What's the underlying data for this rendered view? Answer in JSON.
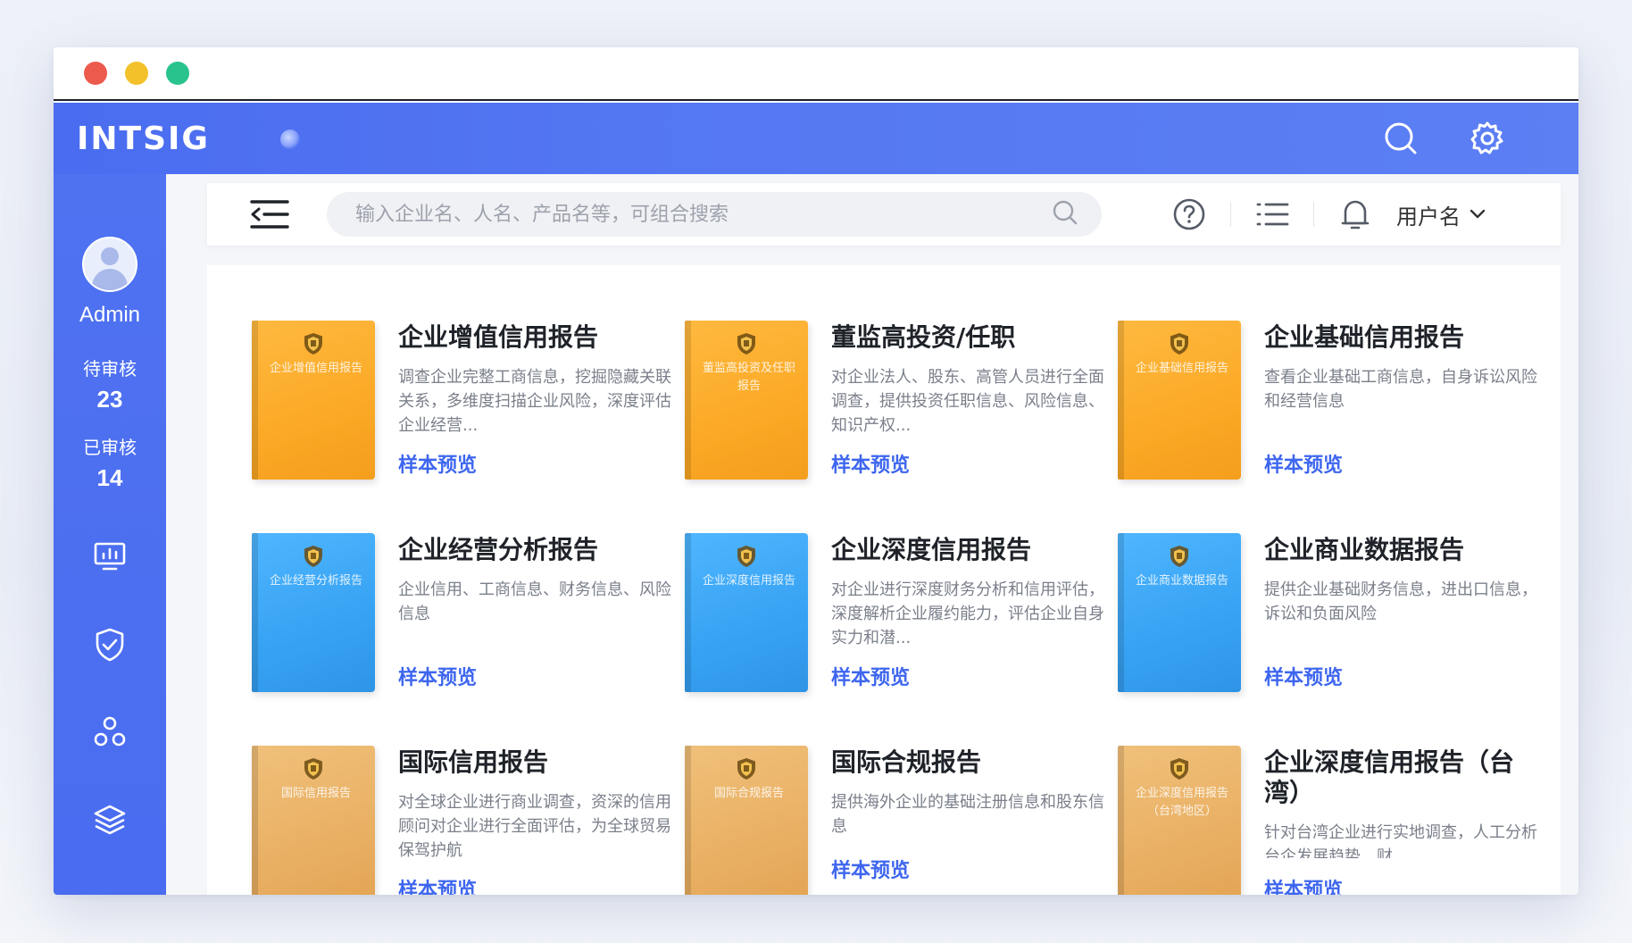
{
  "window": {
    "controls": [
      "close",
      "minimize",
      "maximize"
    ]
  },
  "appbar": {
    "logo": "INTSIG",
    "icons": [
      "search-icon",
      "gear-icon"
    ]
  },
  "sidebar": {
    "user": "Admin",
    "pending_label": "待审核",
    "pending_count": "23",
    "reviewed_label": "已审核",
    "reviewed_count": "14",
    "nav_icons": [
      "dashboard-icon",
      "shield-check-icon",
      "cluster-icon",
      "layers-icon"
    ]
  },
  "toolbar": {
    "search_placeholder": "输入企业名、人名、产品名等，可组合搜索",
    "username": "用户名"
  },
  "colors": {
    "primary": "#4a6cf0",
    "link": "#3e66ef",
    "orange": "#fba926",
    "blue": "#37a2f3",
    "tan": "#e9b064"
  },
  "reports": [
    {
      "cover_color": "orange",
      "cover_text": "企业增值信用报告",
      "title": "企业增值信用报告",
      "desc": "调查企业完整工商信息，挖掘隐藏关联关系，多维度扫描企业风险，深度评估企业经营...",
      "link": "样本预览"
    },
    {
      "cover_color": "orange",
      "cover_text": "董监高投资及任职报告",
      "title": "董监高投资/任职",
      "desc": "对企业法人、股东、高管人员进行全面调查，提供投资任职信息、风险信息、知识产权...",
      "link": "样本预览"
    },
    {
      "cover_color": "orange",
      "cover_text": "企业基础信用报告",
      "title": "企业基础信用报告",
      "desc": "查看企业基础工商信息，自身诉讼风险和经营信息",
      "link": "样本预览"
    },
    {
      "cover_color": "blue",
      "cover_text": "企业经营分析报告",
      "title": "企业经营分析报告",
      "desc": "企业信用、工商信息、财务信息、风险信息",
      "link": "样本预览"
    },
    {
      "cover_color": "blue",
      "cover_text": "企业深度信用报告",
      "title": "企业深度信用报告",
      "desc": "对企业进行深度财务分析和信用评估，深度解析企业履约能力，评估企业自身实力和潜...",
      "link": "样本预览"
    },
    {
      "cover_color": "blue",
      "cover_text": "企业商业数据报告",
      "title": "企业商业数据报告",
      "desc": "提供企业基础财务信息，进出口信息，诉讼和负面风险",
      "link": "样本预览"
    },
    {
      "cover_color": "tan",
      "cover_text": "国际信用报告",
      "title": "国际信用报告",
      "desc": "对全球企业进行商业调查，资深的信用顾问对企业进行全面评估，为全球贸易保驾护航",
      "link": "样本预览"
    },
    {
      "cover_color": "tan",
      "cover_text": "国际合规报告",
      "title": "国际合规报告",
      "desc": "提供海外企业的基础注册信息和股东信息",
      "link": "样本预览"
    },
    {
      "cover_color": "tan",
      "cover_text": "企业深度信用报告（台湾地区）",
      "title": "企业深度信用报告（台湾）",
      "desc": "针对台湾企业进行实地调查，人工分析台企发展趋势、财...",
      "link": "样本预览"
    }
  ]
}
